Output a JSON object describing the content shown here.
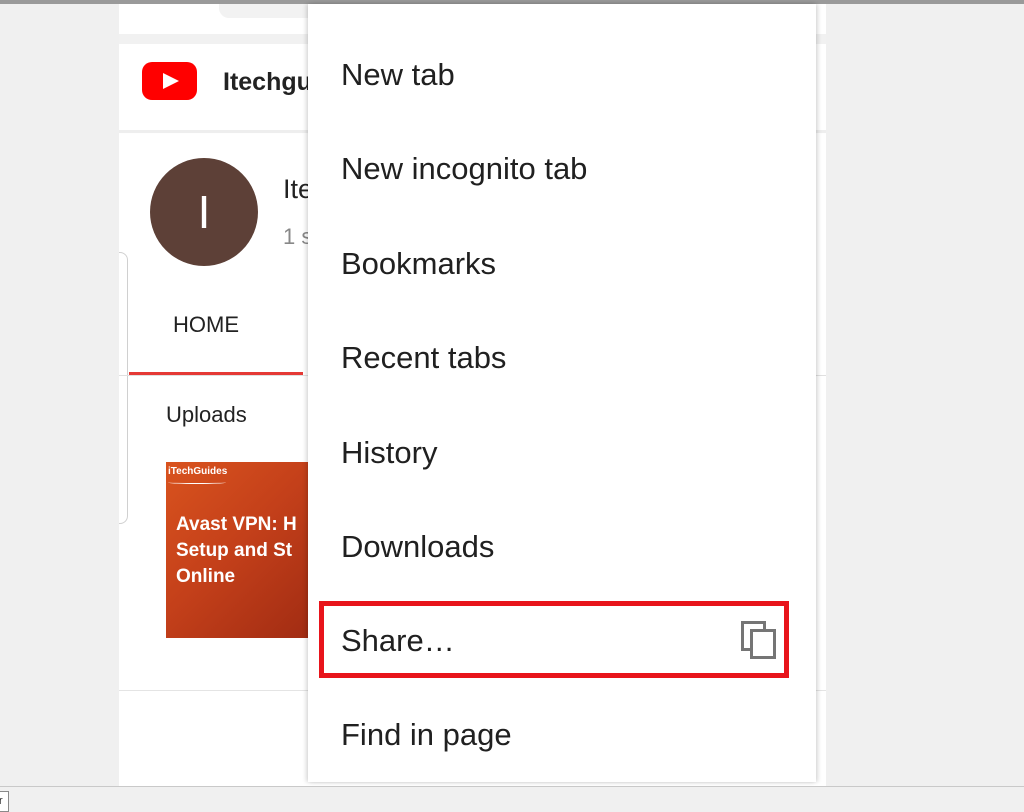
{
  "page": {
    "corner_glyph": "r"
  },
  "youtube": {
    "header_title": "Itechgu",
    "channel_initial": "I",
    "channel_name": "Ite",
    "channel_subs": "1 s",
    "tab_home": "HOME",
    "uploads_label": "Uploads",
    "thumbnail": {
      "brand": "iTechGuides",
      "title": "Avast VPN: H\nSetup and St\nOnline"
    }
  },
  "menu": {
    "items": [
      {
        "label": "New tab"
      },
      {
        "label": "New incognito tab"
      },
      {
        "label": "Bookmarks"
      },
      {
        "label": "Recent tabs"
      },
      {
        "label": "History"
      },
      {
        "label": "Downloads"
      },
      {
        "label": "Share…",
        "icon": "copy-icon",
        "highlighted": true
      },
      {
        "label": "Find in page"
      }
    ]
  },
  "colors": {
    "highlight": "#e8141b",
    "youtube_red": "#ff0000",
    "avatar_bg": "#5d4037",
    "tab_underline": "#e53935"
  }
}
